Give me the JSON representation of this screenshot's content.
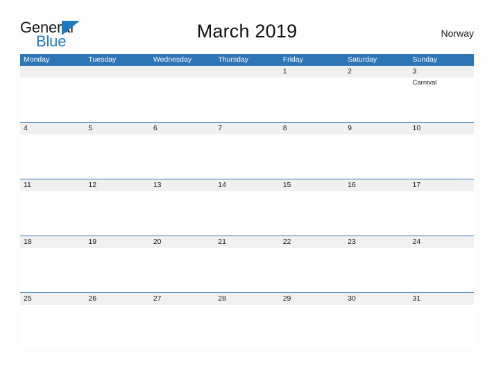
{
  "brand": {
    "word_one": "General",
    "word_two": "Blue",
    "triangle_icon": "blue-triangle-icon",
    "accent_color": "#1f7bc1"
  },
  "header": {
    "title": "March 2019",
    "country": "Norway"
  },
  "theme": {
    "header_blue": "#2e75b6",
    "row_gray": "#f0f0f0",
    "page_background": "#fdfdfd",
    "text_color": "#1a1a1a"
  },
  "calendar": {
    "day_headers": [
      "Monday",
      "Tuesday",
      "Wednesday",
      "Thursday",
      "Friday",
      "Saturday",
      "Sunday"
    ],
    "weeks": [
      {
        "days": [
          {
            "date": "",
            "events": []
          },
          {
            "date": "",
            "events": []
          },
          {
            "date": "",
            "events": []
          },
          {
            "date": "",
            "events": []
          },
          {
            "date": "1",
            "events": []
          },
          {
            "date": "2",
            "events": []
          },
          {
            "date": "3",
            "events": [
              "Carnival"
            ]
          }
        ]
      },
      {
        "days": [
          {
            "date": "4",
            "events": []
          },
          {
            "date": "5",
            "events": []
          },
          {
            "date": "6",
            "events": []
          },
          {
            "date": "7",
            "events": []
          },
          {
            "date": "8",
            "events": []
          },
          {
            "date": "9",
            "events": []
          },
          {
            "date": "10",
            "events": []
          }
        ]
      },
      {
        "days": [
          {
            "date": "11",
            "events": []
          },
          {
            "date": "12",
            "events": []
          },
          {
            "date": "13",
            "events": []
          },
          {
            "date": "14",
            "events": []
          },
          {
            "date": "15",
            "events": []
          },
          {
            "date": "16",
            "events": []
          },
          {
            "date": "17",
            "events": []
          }
        ]
      },
      {
        "days": [
          {
            "date": "18",
            "events": []
          },
          {
            "date": "19",
            "events": []
          },
          {
            "date": "20",
            "events": []
          },
          {
            "date": "21",
            "events": []
          },
          {
            "date": "22",
            "events": []
          },
          {
            "date": "23",
            "events": []
          },
          {
            "date": "24",
            "events": []
          }
        ]
      },
      {
        "days": [
          {
            "date": "25",
            "events": []
          },
          {
            "date": "26",
            "events": []
          },
          {
            "date": "27",
            "events": []
          },
          {
            "date": "28",
            "events": []
          },
          {
            "date": "29",
            "events": []
          },
          {
            "date": "30",
            "events": []
          },
          {
            "date": "31",
            "events": []
          }
        ]
      }
    ]
  }
}
